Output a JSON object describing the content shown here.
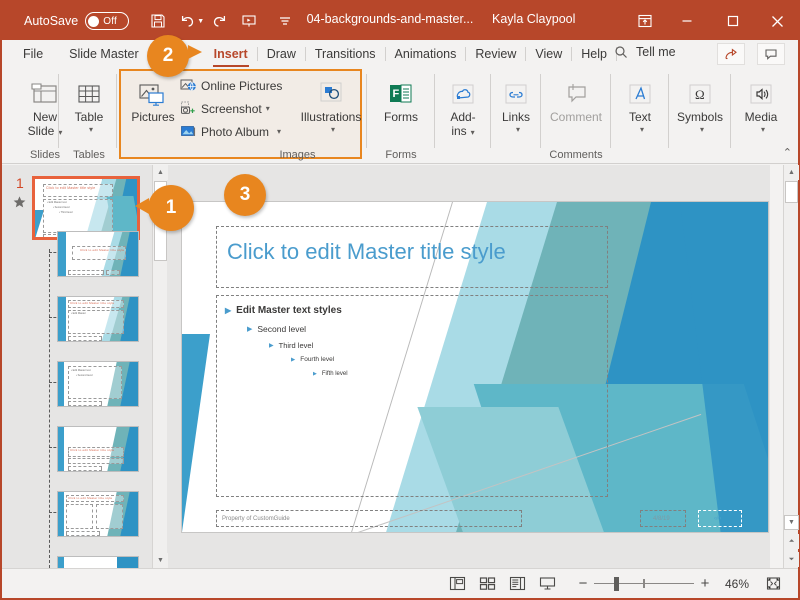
{
  "titlebar": {
    "autosave_label": "AutoSave",
    "autosave_state": "Off",
    "document_title": "04-backgrounds-and-master...",
    "user_name": "Kayla Claypool",
    "icons": {
      "save": "save-icon",
      "undo": "undo-icon",
      "redo": "redo-icon",
      "present": "start-presentation-icon",
      "customize": "customize-quick-access-icon",
      "ribbon_display": "ribbon-display-options-icon",
      "minimize": "minimize-icon",
      "maximize": "maximize-icon",
      "close": "close-icon"
    }
  },
  "tabs": [
    {
      "label": "File",
      "active": false
    },
    {
      "label": "Slide Master",
      "active": false
    },
    {
      "label": "Insert",
      "active": true
    },
    {
      "label": "Draw",
      "active": false
    },
    {
      "label": "Transitions",
      "active": false
    },
    {
      "label": "Animations",
      "active": false
    },
    {
      "label": "Review",
      "active": false
    },
    {
      "label": "View",
      "active": false
    },
    {
      "label": "Help",
      "active": false
    }
  ],
  "search": {
    "label": "Tell me",
    "icon": "search-icon"
  },
  "ribbon": {
    "groups": [
      {
        "name": "Slides",
        "label": "Slides"
      },
      {
        "name": "Tables",
        "label": "Tables"
      },
      {
        "name": "Images",
        "label": "Images"
      },
      {
        "name": "Forms",
        "label": "Forms"
      },
      {
        "name": "Comments",
        "label": "Comments"
      }
    ],
    "buttons": {
      "new_slide": "New\nSlide",
      "new_slide_l1": "New",
      "new_slide_l2": "Slide",
      "table": "Table",
      "pictures": "Pictures",
      "online_pictures": "Online Pictures",
      "screenshot": "Screenshot",
      "photo_album": "Photo Album",
      "illustrations": "Illustrations",
      "forms": "Forms",
      "addins_l1": "Add-",
      "addins_l2": "ins",
      "links": "Links",
      "comment": "Comment",
      "text": "Text",
      "symbols": "Symbols",
      "media": "Media"
    },
    "collapse_caret": "⌃",
    "highlight_color": "#e8861f"
  },
  "thumbnails": {
    "master_number": "1",
    "star_icon": "preserve-master-icon",
    "selected_index": 0,
    "slides": [
      {
        "title": "Click to edit Master title style",
        "type": "master"
      },
      {
        "title": "Click to edit Master title style",
        "type": "title-layout"
      },
      {
        "title": "Click to edit Master title style",
        "type": "title-content"
      },
      {
        "title": "",
        "type": "content-only"
      },
      {
        "title": "Click to edit Master title style",
        "type": "section-header"
      },
      {
        "title": "Click to edit Master title style",
        "type": "two-content"
      },
      {
        "title": "",
        "type": "comparison"
      }
    ]
  },
  "slide": {
    "title_placeholder": "Click to edit Master title style",
    "bullets": [
      {
        "text": "Edit Master text styles",
        "level": 1
      },
      {
        "text": "Second level",
        "level": 2
      },
      {
        "text": "Third level",
        "level": 3
      },
      {
        "text": "Fourth level",
        "level": 4
      },
      {
        "text": "Fifth level",
        "level": 5
      }
    ],
    "footer_text": "Property of CustomGuide",
    "date_text": "4/8/19",
    "slide_number_text": "‹#›",
    "title_color": "#4a9ccd",
    "background_colors": [
      "#3c9fcb",
      "#5eb7c8",
      "#6fb3b8",
      "#2e93c4",
      "#a9dbe6",
      "#cfeaf1"
    ]
  },
  "statusbar": {
    "views": [
      {
        "name": "normal-view",
        "label": "Normal"
      },
      {
        "name": "slide-sorter-view",
        "label": "Slide Sorter"
      },
      {
        "name": "reading-view",
        "label": "Reading View"
      },
      {
        "name": "slide-show-view",
        "label": "Slide Show"
      }
    ],
    "zoom_out": "−",
    "zoom_in": "+",
    "zoom_level": "46%",
    "fit_icon": "fit-to-window-icon"
  },
  "callouts": [
    {
      "number": "1",
      "target": "selected-master-thumbnail"
    },
    {
      "number": "2",
      "target": "insert-tab"
    },
    {
      "number": "3",
      "target": "slide-canvas"
    }
  ]
}
